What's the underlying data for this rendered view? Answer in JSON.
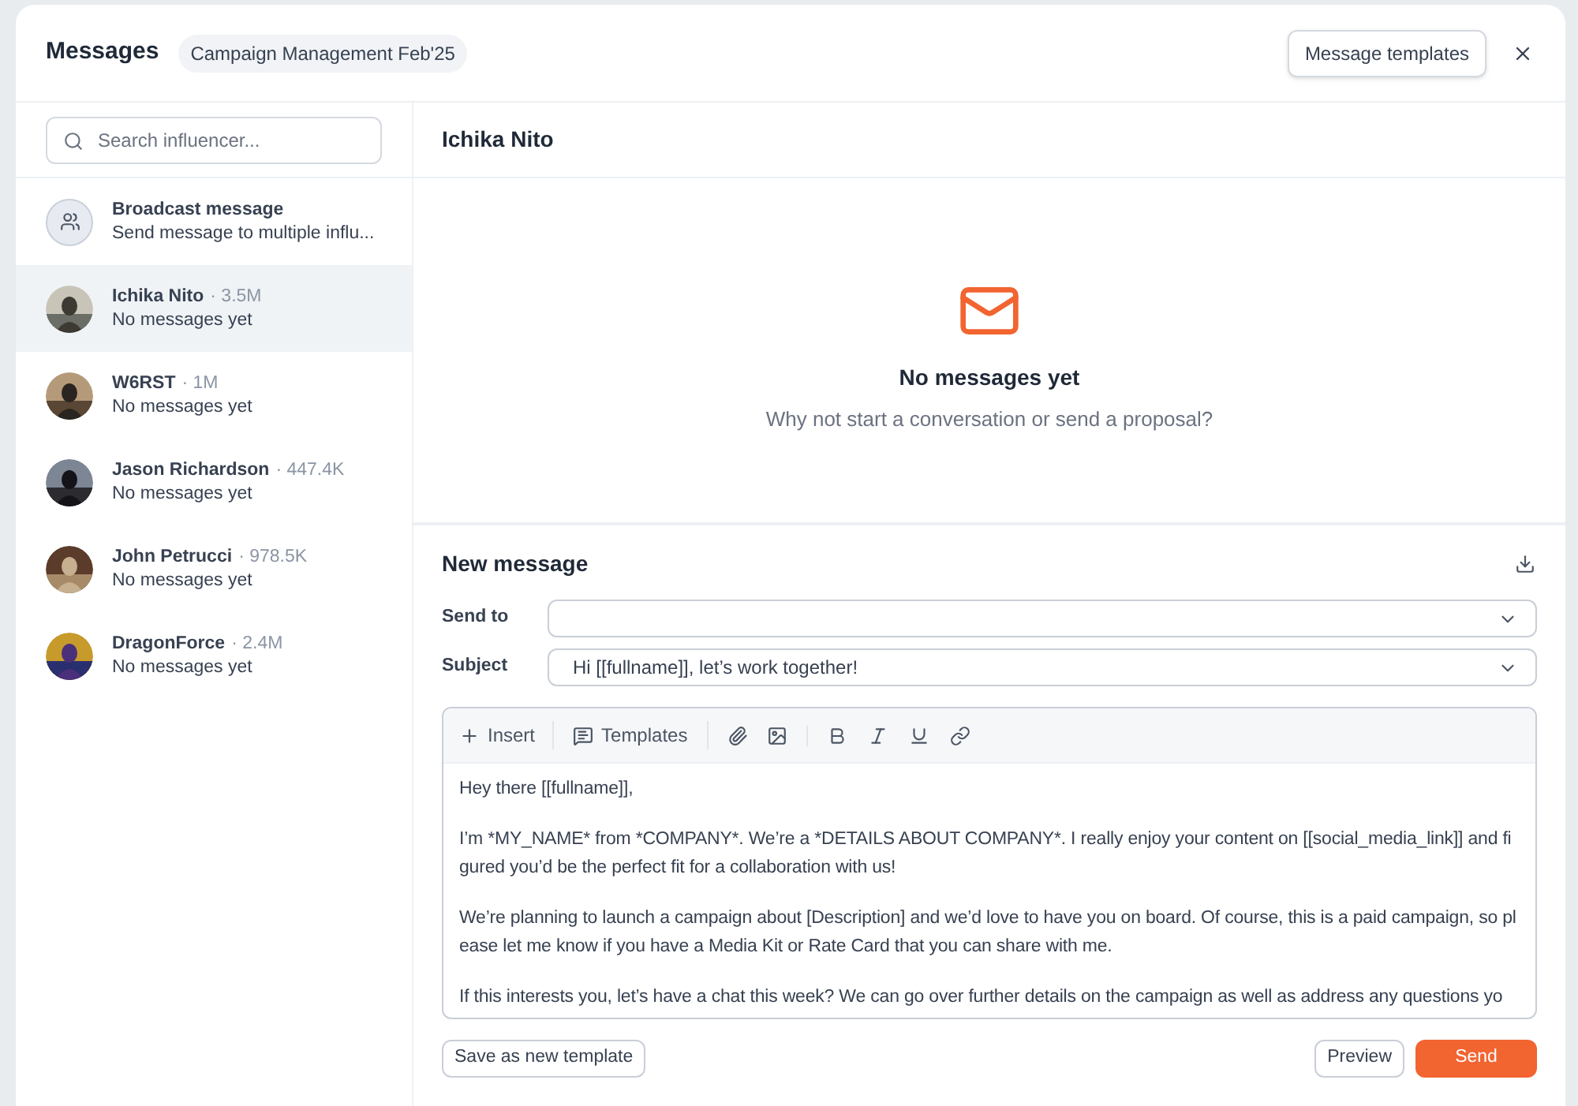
{
  "header": {
    "title": "Messages",
    "badge": "Campaign Management Feb'25",
    "templates_button": "Message templates"
  },
  "sidebar": {
    "search": {
      "placeholder": "Search influencer..."
    },
    "items": [
      {
        "kind": "broadcast",
        "name": "Broadcast message",
        "subtitle": "Send message to multiple influ...",
        "selected": false
      },
      {
        "kind": "influencer",
        "name": "Ichika Nito",
        "meta": "· 3.5M",
        "subtitle": "No messages yet",
        "selected": true
      },
      {
        "kind": "influencer",
        "name": "W6RST",
        "meta": "· 1M",
        "subtitle": "No messages yet",
        "selected": false
      },
      {
        "kind": "influencer",
        "name": "Jason Richardson",
        "meta": "· 447.4K",
        "subtitle": "No messages yet",
        "selected": false
      },
      {
        "kind": "influencer",
        "name": "John Petrucci",
        "meta": "· 978.5K",
        "subtitle": "No messages yet",
        "selected": false
      },
      {
        "kind": "influencer",
        "name": "DragonForce",
        "meta": "· 2.4M",
        "subtitle": "No messages yet",
        "selected": false
      }
    ]
  },
  "conversation": {
    "name": "Ichika Nito",
    "empty_state": {
      "title": "No messages yet",
      "subtitle": "Why not start a conversation or send a proposal?"
    }
  },
  "composer": {
    "title": "New message",
    "fields": [
      {
        "label": "Send to"
      },
      {
        "label": "Subject",
        "value": "Hi [[fullname]], let’s work together!"
      }
    ],
    "toolbar": {
      "insert": "Insert",
      "templates": "Templates"
    },
    "body": [
      "Hey there [[fullname]],",
      "I’m *MY_NAME* from *COMPANY*. We’re a *DETAILS ABOUT COMPANY*. I really enjoy your content on [[social_media_link]] and figured you’d be the perfect fit for a collaboration with us!",
      "We’re planning to launch a campaign about [Description] and we’d love to have you on board. Of course, this is a paid campaign, so please let me know if you have a Media Kit or Rate Card that you can share with me.",
      "If this interests you, let’s have a chat this week? We can go over further details on the campaign as well as address any questions yo"
    ],
    "buttons": {
      "save_template": "Save as new template",
      "preview": "Preview",
      "send": "Send"
    }
  }
}
